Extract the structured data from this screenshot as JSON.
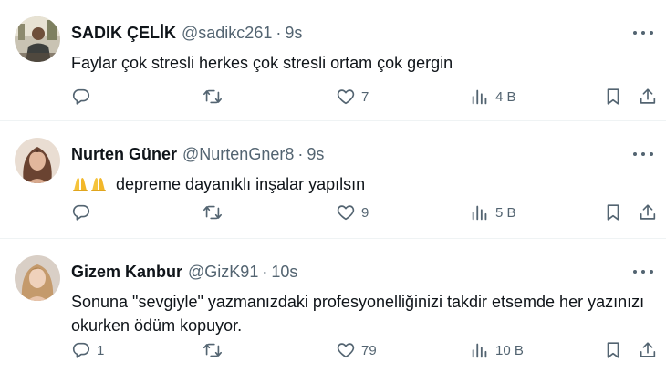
{
  "tweets": [
    {
      "name": "SADIK ÇELİK",
      "handle": "@sadikc261",
      "time": "9s",
      "emoji": "",
      "text": "Faylar çok stresli herkes çok stresli ortam çok gergin",
      "replies": "",
      "retweets": "",
      "likes": "7",
      "views": "4 B"
    },
    {
      "name": "Nurten Güner",
      "handle": "@NurtenGner8",
      "time": "9s",
      "emoji": "🙏🙏",
      "text": "depreme dayanıklı inşalar yapılsın",
      "replies": "",
      "retweets": "",
      "likes": "9",
      "views": "5 B"
    },
    {
      "name": "Gizem Kanbur",
      "handle": "@GizK91",
      "time": "10s",
      "emoji": "",
      "text": "Sonuna \"sevgiyle\" yazmanızdaki profesyonelliğinizi takdir etsemde her yazınızı okurken ödüm kopuyor.",
      "replies": "1",
      "retweets": "",
      "likes": "79",
      "views": "10 B"
    }
  ],
  "colors": {
    "text": "#0f1419",
    "secondary": "#536471",
    "divider": "#eff3f4",
    "emoji": "#f5c33b"
  },
  "icons": [
    "reply-icon",
    "retweet-icon",
    "like-icon",
    "views-icon",
    "bookmark-icon",
    "share-icon",
    "more-icon"
  ]
}
